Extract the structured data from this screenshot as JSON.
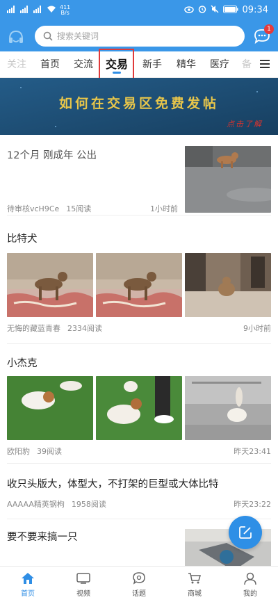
{
  "status_bar": {
    "network_speed_value": "411",
    "network_speed_unit": "B/s",
    "battery": "",
    "time": "09:34"
  },
  "header": {
    "search_placeholder": "搜索关键词",
    "message_badge": "1"
  },
  "tabs": [
    {
      "label": "关注"
    },
    {
      "label": "首页"
    },
    {
      "label": "交流"
    },
    {
      "label": "交易",
      "active": true
    },
    {
      "label": "新手"
    },
    {
      "label": "精华"
    },
    {
      "label": "医疗"
    },
    {
      "label": "备"
    }
  ],
  "banner": {
    "title": "如何在交易区免费发帖",
    "subtitle": "点击了解"
  },
  "posts": [
    {
      "title": "12个月 刚成年 公出",
      "author": "待审核vcH9Ce",
      "reads": "15阅读",
      "time": "1小时前"
    },
    {
      "title": "比特犬",
      "author": "无悔的藏蓝青春",
      "reads": "2334阅读",
      "time": "9小时前"
    },
    {
      "title": "小杰克",
      "author": "欧阳豹",
      "reads": "39阅读",
      "time": "昨天23:41"
    },
    {
      "title": "收只头版大，体型大，不打架的巨型或大体比特",
      "author": "AAAAA精英钢枸",
      "reads": "1958阅读",
      "time": "昨天23:22"
    },
    {
      "title": "要不要来搞一只"
    }
  ],
  "bottom_nav": [
    {
      "label": "首页",
      "icon": "home-icon",
      "active": true
    },
    {
      "label": "视频",
      "icon": "video-icon"
    },
    {
      "label": "话题",
      "icon": "topic-icon"
    },
    {
      "label": "商城",
      "icon": "cart-icon"
    },
    {
      "label": "我的",
      "icon": "profile-icon"
    }
  ],
  "colors": {
    "brand_blue": "#3a97e8",
    "active_blue": "#2f8ee5",
    "banner_bg": "#1d4f76",
    "banner_title": "#e8c64a",
    "banner_sub": "#d8332e",
    "highlight_red": "#e03a3a"
  }
}
